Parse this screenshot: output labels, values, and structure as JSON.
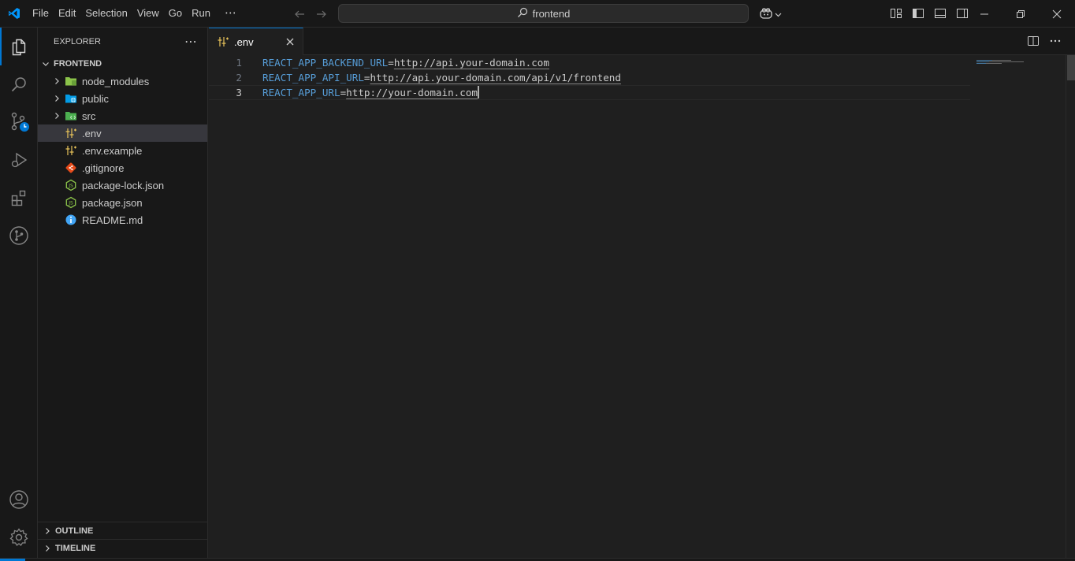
{
  "titlebar": {
    "menu": [
      "File",
      "Edit",
      "Selection",
      "View",
      "Go",
      "Run",
      "⋯"
    ],
    "search_text": "frontend"
  },
  "activity_bar": {
    "items": [
      "explorer",
      "search",
      "source-control",
      "run-and-debug",
      "extensions",
      "git-graph"
    ],
    "bottom_items": [
      "accounts",
      "manage"
    ]
  },
  "sidebar": {
    "title": "EXPLORER",
    "more": "⋯",
    "root_folder": "FRONTEND",
    "items": [
      {
        "label": "node_modules",
        "type": "folder",
        "icon": "node-folder-icon"
      },
      {
        "label": "public",
        "type": "folder",
        "icon": "public-folder-icon"
      },
      {
        "label": "src",
        "type": "folder",
        "icon": "src-folder-icon"
      },
      {
        "label": ".env",
        "type": "file",
        "icon": "env-icon",
        "selected": true
      },
      {
        "label": ".env.example",
        "type": "file",
        "icon": "env-icon"
      },
      {
        "label": ".gitignore",
        "type": "file",
        "icon": "git-icon"
      },
      {
        "label": "package-lock.json",
        "type": "file",
        "icon": "nodejs-icon"
      },
      {
        "label": "package.json",
        "type": "file",
        "icon": "nodejs-icon"
      },
      {
        "label": "README.md",
        "type": "file",
        "icon": "info-icon"
      }
    ],
    "outline_label": "OUTLINE",
    "timeline_label": "TIMELINE"
  },
  "editor": {
    "tab_label": ".env",
    "lines": [
      {
        "number": "1",
        "key": "REACT_APP_BACKEND_URL",
        "eq": "=",
        "value": "http://api.your-domain.com"
      },
      {
        "number": "2",
        "key": "REACT_APP_API_URL",
        "eq": "=",
        "value": "http://api.your-domain.com/api/v1/frontend"
      },
      {
        "number": "3",
        "key": "REACT_APP_URL",
        "eq": "=",
        "value": "http://your-domain.com"
      }
    ]
  },
  "colors": {
    "accent": "#0078d4",
    "env_key": "#569cd6",
    "background": "#1f1f1f",
    "sidebar_bg": "#181818"
  }
}
